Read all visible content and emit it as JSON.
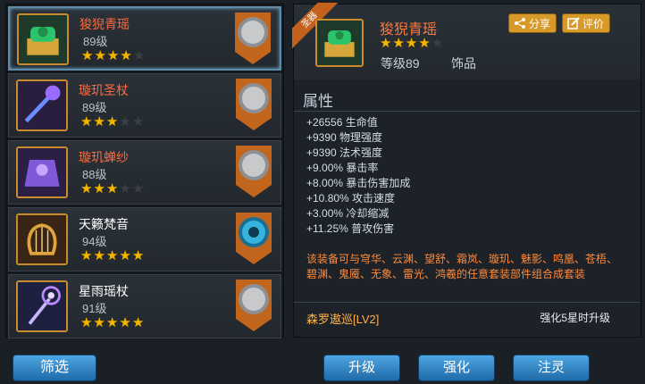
{
  "items": [
    {
      "name": "狻猊青瑶",
      "level": "89级",
      "stars": 4,
      "max_stars": 5
    },
    {
      "name": "璇玑圣杖",
      "level": "89级",
      "stars": 3,
      "max_stars": 5
    },
    {
      "name": "璇玑蝉纱",
      "level": "88级",
      "stars": 3,
      "max_stars": 5
    },
    {
      "name": "天籁梵音",
      "level": "94级",
      "stars": 5,
      "max_stars": 5
    },
    {
      "name": "星雨瑶杖",
      "level": "91级",
      "stars": 5,
      "max_stars": 5
    }
  ],
  "filter_label": "筛选",
  "detail": {
    "ribbon": "圣器",
    "name": "狻猊青瑶",
    "stars": 4,
    "max_stars": 5,
    "level": "等级89",
    "type": "饰品",
    "share": "分享",
    "review": "评价",
    "attr_title": "属性",
    "attrs": [
      "+26556 生命值",
      "+9390 物理强度",
      "+9390 法术强度",
      "+9.00% 暴击率",
      "+8.00% 暴击伤害加成",
      "+10.80% 攻击速度",
      "+3.00% 冷却缩减",
      "+11.25% 普攻伤害"
    ],
    "set_desc": "该装备可与穹华、云渊、望舒、霜岚、璇玑、魅影、鸣凰、苍梧、碧渊、鬼魇、无象、雷光、鸿羲的任意套装部件组合成套装",
    "set_name": "森罗遨巡[LV2]",
    "set_condition": "强化5星时升级"
  },
  "actions": [
    "升级",
    "强化",
    "注灵"
  ],
  "colors": {
    "accent_orange": "#ff7a3d",
    "star": "#f4b500",
    "button_blue": "#2f86c8"
  }
}
